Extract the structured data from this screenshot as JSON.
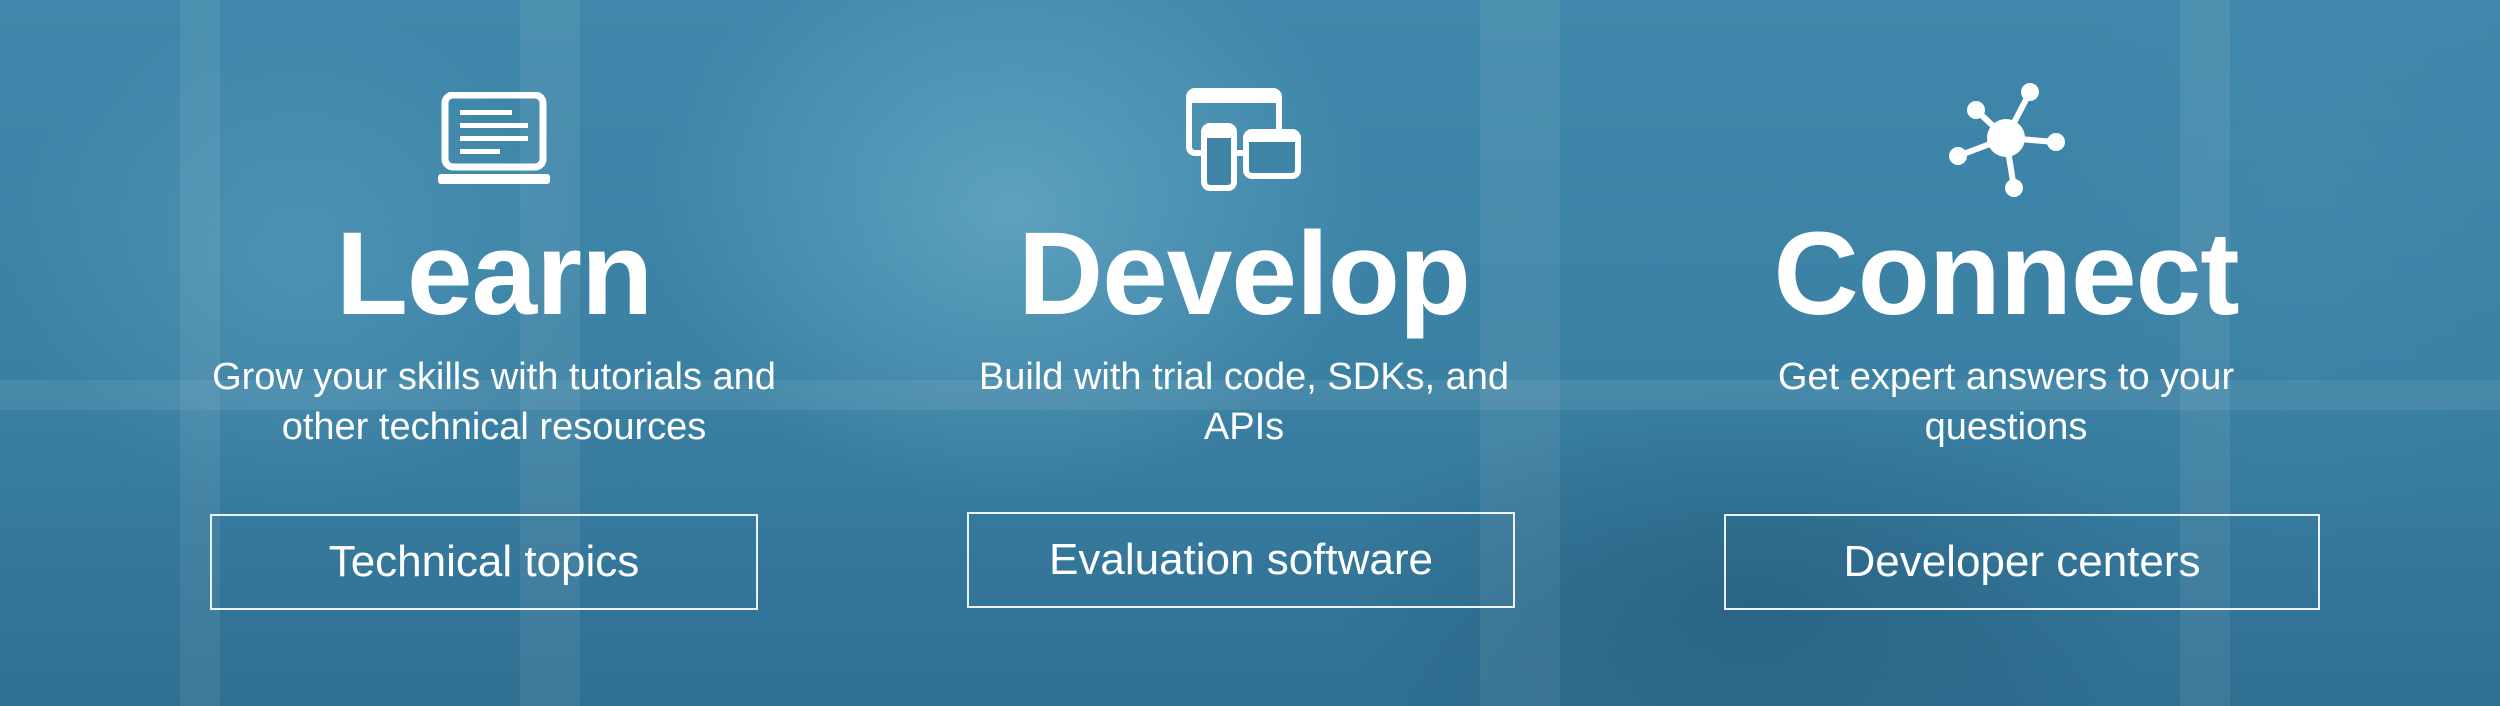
{
  "hero": {
    "learn": {
      "icon": "laptop-icon",
      "title": "Learn",
      "description": "Grow your skills with tutorials and other technical resources",
      "button_label": "Technical topics"
    },
    "develop": {
      "icon": "devices-icon",
      "title": "Develop",
      "description": "Build with trial code, SDKs, and APIs",
      "button_label": "Evaluation software"
    },
    "connect": {
      "icon": "network-icon",
      "title": "Connect",
      "description": "Get expert answers to your questions",
      "button_label": "Developer centers"
    }
  },
  "colors": {
    "background": "#3f84a6",
    "text": "#ffffff",
    "button_border": "#ffffff"
  }
}
